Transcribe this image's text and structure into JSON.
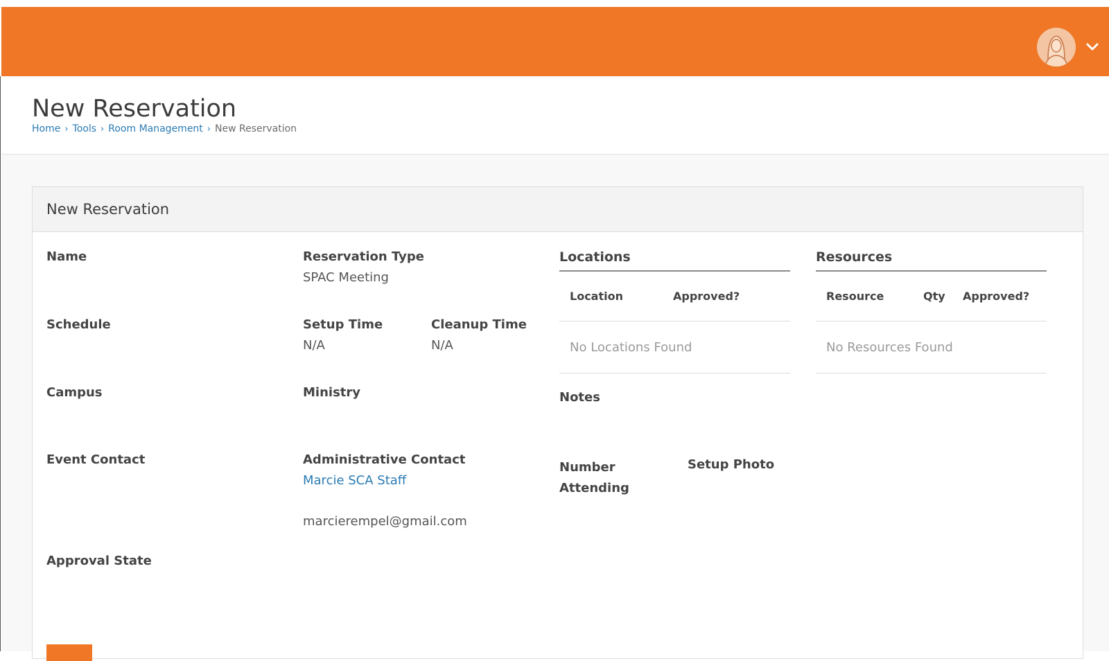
{
  "header": {
    "brand_color": "#ef7726",
    "avatar_icon": "user-avatar-icon",
    "menu_icon": "chevron-down-icon"
  },
  "page": {
    "title": "New Reservation",
    "breadcrumb": [
      "Home",
      "Tools",
      "Room Management",
      "New Reservation"
    ]
  },
  "panel": {
    "title": "New Reservation",
    "fields": {
      "name_label": "Name",
      "reservation_type_label": "Reservation Type",
      "reservation_type_value": "SPAC Meeting",
      "schedule_label": "Schedule",
      "setup_time_label": "Setup Time",
      "setup_time_value": "N/A",
      "cleanup_time_label": "Cleanup Time",
      "cleanup_time_value": "N/A",
      "campus_label": "Campus",
      "ministry_label": "Ministry",
      "event_contact_label": "Event Contact",
      "admin_contact_label": "Administrative Contact",
      "admin_contact_name": "Marcie SCA Staff",
      "admin_contact_email": "marcierempel@gmail.com",
      "approval_state_label": "Approval State",
      "notes_label": "Notes",
      "number_attending_label": "Number Attending",
      "setup_photo_label": "Setup Photo"
    },
    "locations": {
      "title": "Locations",
      "columns": [
        "Location",
        "Approved?"
      ],
      "empty": "No Locations Found"
    },
    "resources": {
      "title": "Resources",
      "columns": [
        "Resource",
        "Qty",
        "Approved?"
      ],
      "empty": "No Resources Found"
    }
  }
}
